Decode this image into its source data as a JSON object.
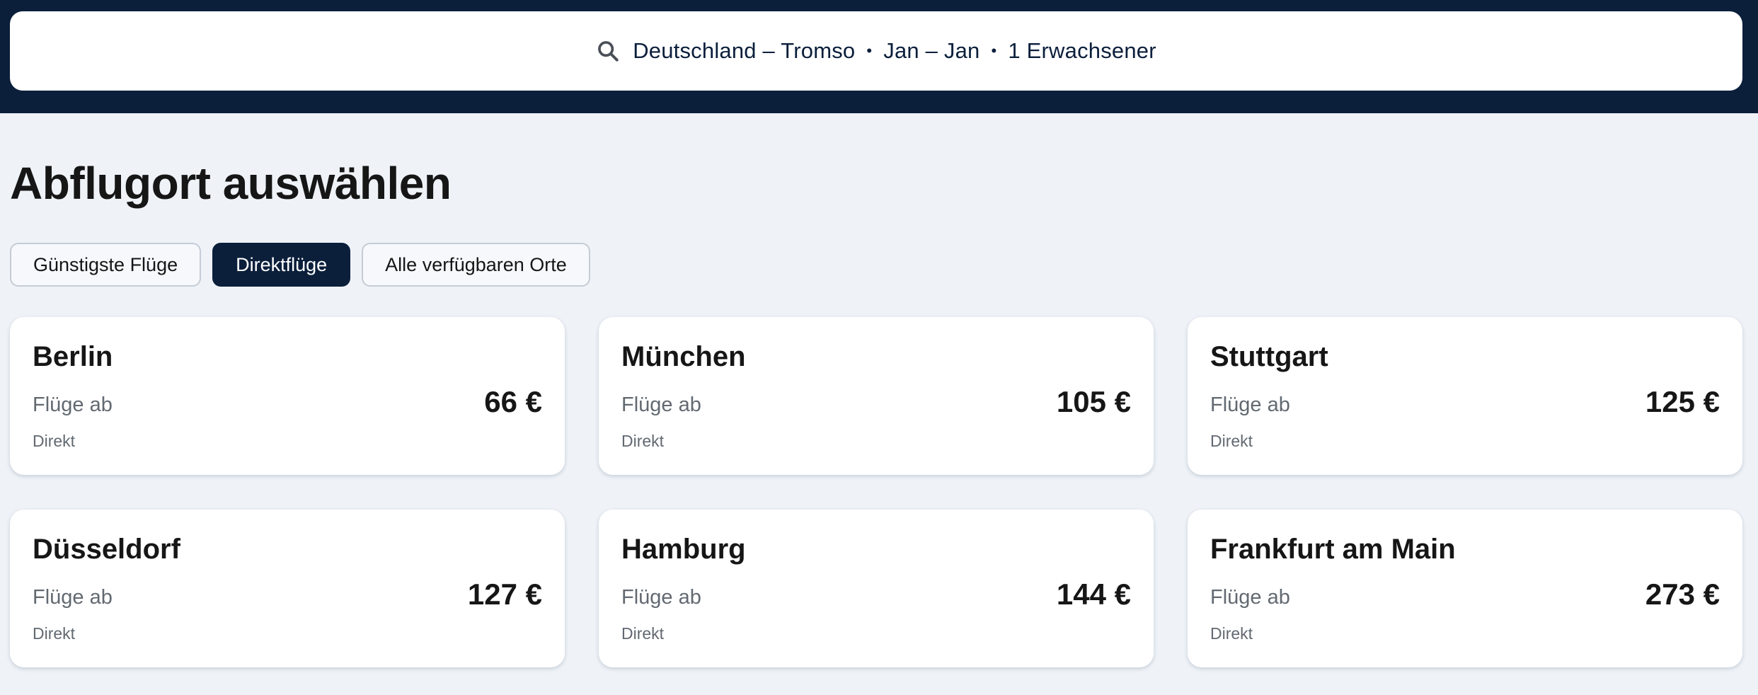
{
  "search": {
    "icon": "search-icon",
    "route": "Deutschland – Tromso",
    "dates": "Jan – Jan",
    "passengers": "1 Erwachsener",
    "separator": "•"
  },
  "page_title": "Abflugort auswählen",
  "filters": [
    {
      "label": "Günstigste Flüge",
      "active": false
    },
    {
      "label": "Direktflüge",
      "active": true
    },
    {
      "label": "Alle verfügbaren Orte",
      "active": false
    }
  ],
  "cards": [
    {
      "city": "Berlin",
      "from_label": "Flüge ab",
      "price": "66 €",
      "stops": "Direkt"
    },
    {
      "city": "München",
      "from_label": "Flüge ab",
      "price": "105 €",
      "stops": "Direkt"
    },
    {
      "city": "Stuttgart",
      "from_label": "Flüge ab",
      "price": "125 €",
      "stops": "Direkt"
    },
    {
      "city": "Düsseldorf",
      "from_label": "Flüge ab",
      "price": "127 €",
      "stops": "Direkt"
    },
    {
      "city": "Hamburg",
      "from_label": "Flüge ab",
      "price": "144 €",
      "stops": "Direkt"
    },
    {
      "city": "Frankfurt am Main",
      "from_label": "Flüge ab",
      "price": "273 €",
      "stops": "Direkt"
    }
  ],
  "colors": {
    "header_bg": "#0b1f3b",
    "page_bg": "#eff3f8",
    "active_chip": "#0b1f3b",
    "muted_text": "#626971"
  }
}
